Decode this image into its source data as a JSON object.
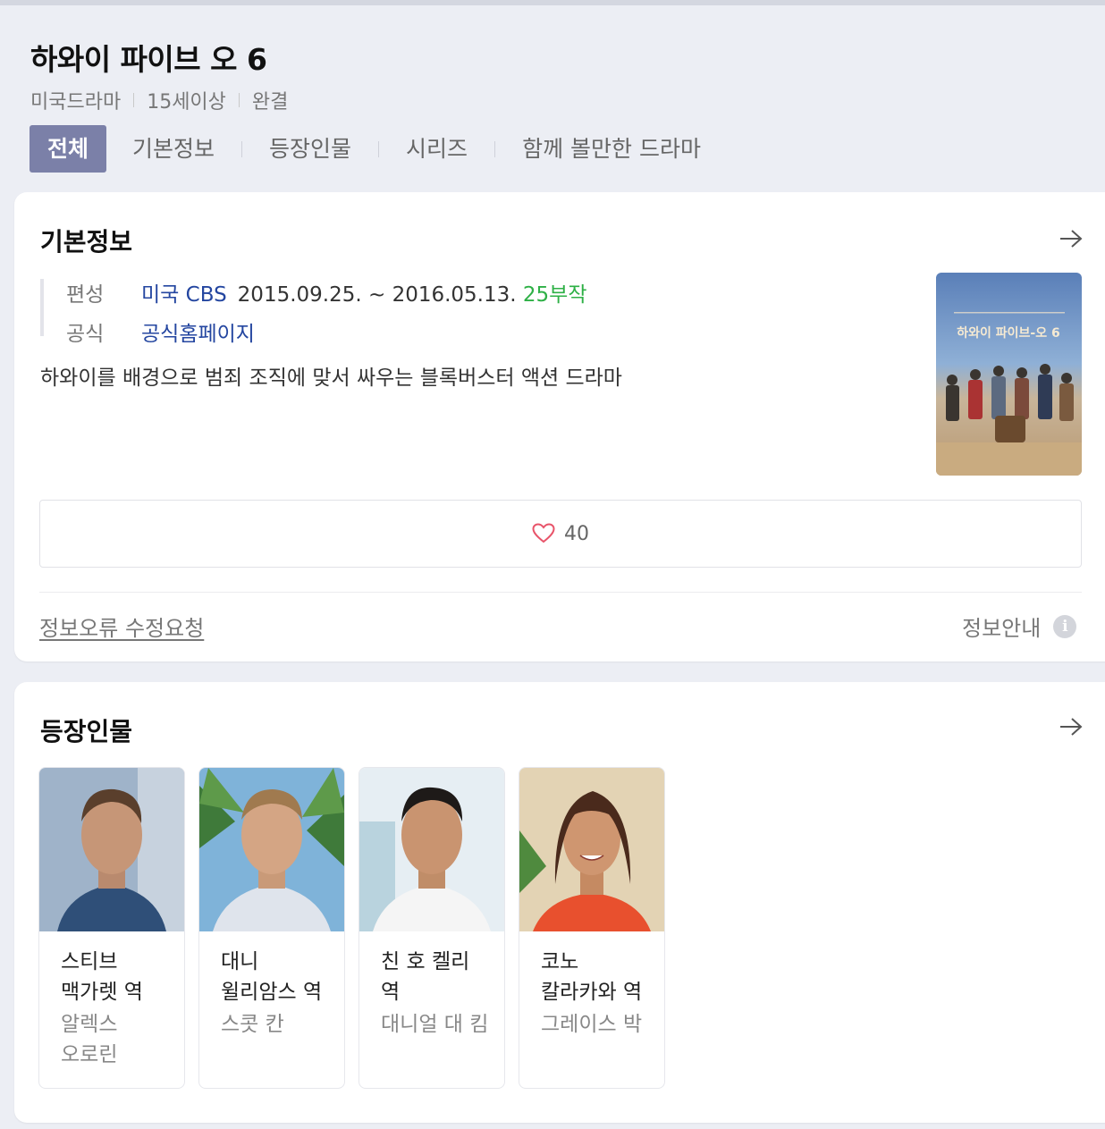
{
  "header": {
    "title": "하와이 파이브 오 6",
    "meta": [
      "미국드라마",
      "15세이상",
      "완결"
    ],
    "tabs": [
      "전체",
      "기본정보",
      "등장인물",
      "시리즈",
      "함께 볼만한 드라마"
    ]
  },
  "basic_info": {
    "heading": "기본정보",
    "broadcast_key": "편성",
    "broadcast_channel": "미국 CBS",
    "broadcast_dates": "2015.09.25. ~ 2016.05.13.",
    "episodes": "25부작",
    "official_key": "공식",
    "official_link": "공식홈페이지",
    "description": "하와이를 배경으로 범죄 조직에 맞서 싸우는 블록버스터 액션 드라마",
    "poster_title": "하와이 파이브-오 6",
    "likes": "40",
    "report_link": "정보오류 수정요청",
    "info_guide": "정보안내",
    "colors": {
      "link": "#2446a0",
      "episodes": "#2eb046",
      "tab_active": "#7b80a8",
      "heart": "#e8546a"
    }
  },
  "cast": {
    "heading": "등장인물",
    "members": [
      {
        "role": "스티브 맥가렛 역",
        "actor": "알렉스 오로린"
      },
      {
        "role": "대니 윌리암스 역",
        "actor": "스콧 칸"
      },
      {
        "role": "친 호 켈리 역",
        "actor": "대니얼 대 킴"
      },
      {
        "role": "코노 칼라카와 역",
        "actor": "그레이스 박"
      }
    ]
  },
  "icons": [
    "arrow-right-icon",
    "heart-icon",
    "info-icon"
  ]
}
